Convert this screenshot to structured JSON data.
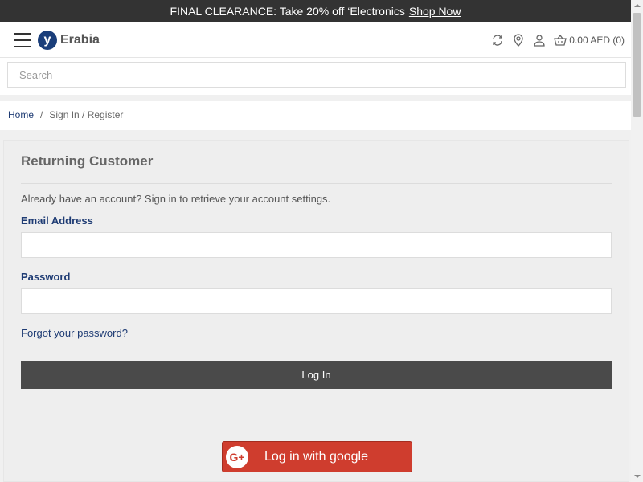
{
  "promo": {
    "text": "FINAL CLEARANCE: Take 20% off ‘Electronics",
    "link": "Shop Now"
  },
  "header": {
    "logo_letter": "y",
    "logo_text": "Erabia",
    "cart_text": "0.00 AED (0)",
    "icons": [
      "menu-icon",
      "compare-icon",
      "location-icon",
      "user-icon",
      "basket-icon"
    ]
  },
  "search": {
    "placeholder": "Search"
  },
  "breadcrumb": {
    "home": "Home",
    "separator": "/",
    "current": "Sign In / Register"
  },
  "login": {
    "title": "Returning Customer",
    "intro": "Already have an account? Sign in to retrieve your account settings.",
    "email_label": "Email Address",
    "email_value": "",
    "password_label": "Password",
    "password_value": "",
    "forgot": "Forgot your password?",
    "submit": "Log In",
    "google": "Log in with google",
    "google_icon_text": "G+"
  },
  "colors": {
    "promo_bg": "#333333",
    "brand_blue": "#1f3c74",
    "button_dark": "#4a4a4a",
    "google_red": "#cf3d2e"
  }
}
